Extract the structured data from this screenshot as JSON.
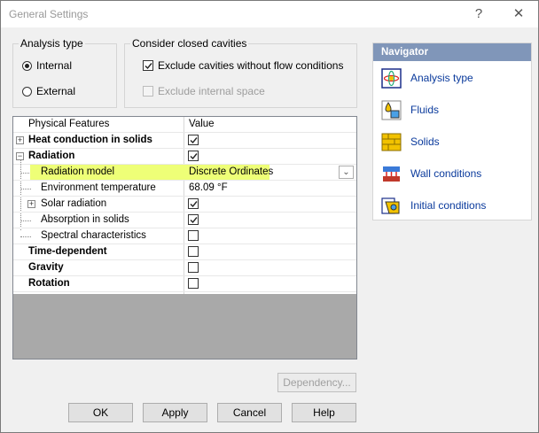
{
  "window": {
    "title": "General Settings",
    "help_label": "?",
    "close_label": "✕"
  },
  "analysis_type": {
    "label": "Analysis type",
    "options": [
      {
        "label": "Internal",
        "selected": true
      },
      {
        "label": "External",
        "selected": false
      }
    ]
  },
  "cavities": {
    "label": "Consider closed cavities",
    "options": [
      {
        "label": "Exclude cavities without flow conditions",
        "checked": true,
        "enabled": true
      },
      {
        "label": "Exclude internal space",
        "checked": false,
        "enabled": false
      }
    ]
  },
  "table": {
    "headers": [
      "Physical Features",
      "Value"
    ],
    "rows": [
      {
        "name": "Heat conduction in solids",
        "bold": true,
        "expander": "+",
        "value": "",
        "checked": true
      },
      {
        "name": "Radiation",
        "bold": true,
        "expander": "−",
        "value": "",
        "checked": true
      },
      {
        "name": "Radiation model",
        "bold": false,
        "expander": "",
        "value": "Discrete Ordinates",
        "checked": null,
        "highlighted": true
      },
      {
        "name": "Environment temperature",
        "bold": false,
        "expander": "",
        "value": "68.09 °F",
        "checked": null
      },
      {
        "name": "Solar radiation",
        "bold": false,
        "expander": "+",
        "value": "",
        "checked": true
      },
      {
        "name": "Absorption in solids",
        "bold": false,
        "expander": "",
        "value": "",
        "checked": true
      },
      {
        "name": "Spectral characteristics",
        "bold": false,
        "expander": "",
        "value": "",
        "checked": false
      },
      {
        "name": "Time-dependent",
        "bold": true,
        "expander": "",
        "value": "",
        "checked": false
      },
      {
        "name": "Gravity",
        "bold": true,
        "expander": "",
        "value": "",
        "checked": false
      },
      {
        "name": "Rotation",
        "bold": true,
        "expander": "",
        "value": "",
        "checked": false
      }
    ]
  },
  "navigator": {
    "title": "Navigator",
    "items": [
      {
        "label": "Analysis type",
        "icon": "analysis-type-icon"
      },
      {
        "label": "Fluids",
        "icon": "fluids-icon"
      },
      {
        "label": "Solids",
        "icon": "solids-icon"
      },
      {
        "label": "Wall conditions",
        "icon": "wall-conditions-icon"
      },
      {
        "label": "Initial conditions",
        "icon": "initial-conditions-icon"
      }
    ]
  },
  "buttons": {
    "dependency": "Dependency...",
    "ok": "OK",
    "apply": "Apply",
    "cancel": "Cancel",
    "help": "Help"
  },
  "colors": {
    "highlight": "#eeff77",
    "navigator_header": "#8096b9",
    "link": "#0a3a9c"
  }
}
